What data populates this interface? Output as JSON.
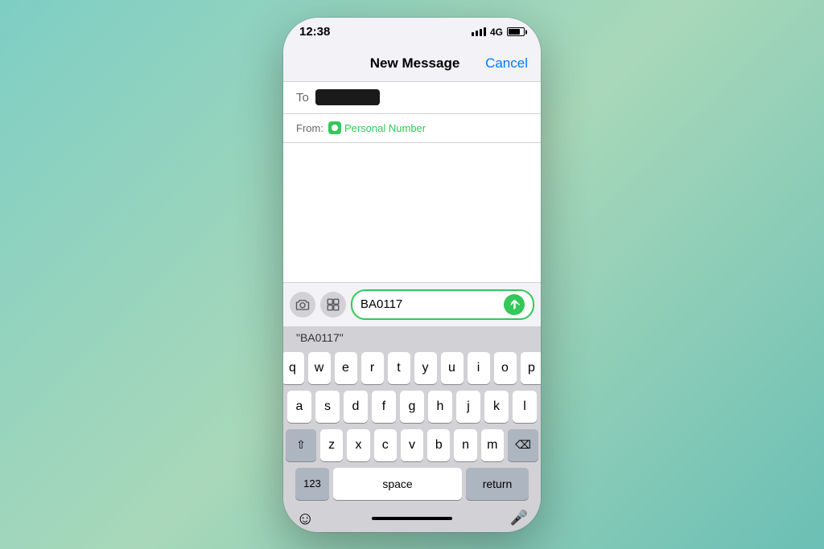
{
  "statusBar": {
    "time": "12:38",
    "signal": "4G",
    "battery": 80
  },
  "navBar": {
    "title": "New Message",
    "cancelLabel": "Cancel"
  },
  "compose": {
    "toLabel": "To",
    "fromLabel": "From:",
    "fromNumber": "Personal Number",
    "messageInputValue": "BA0117",
    "autocomplete": "\"BA0117\""
  },
  "toolbar": {
    "cameraLabel": "camera",
    "appLabel": "app",
    "sendLabel": "send"
  },
  "keyboard": {
    "row1": [
      "q",
      "w",
      "e",
      "r",
      "t",
      "y",
      "u",
      "i",
      "o",
      "p"
    ],
    "row2": [
      "a",
      "s",
      "d",
      "f",
      "g",
      "h",
      "j",
      "k",
      "l"
    ],
    "row3": [
      "z",
      "x",
      "c",
      "v",
      "b",
      "n",
      "m"
    ],
    "spaceLabel": "space",
    "returnLabel": "return",
    "numbersLabel": "123",
    "deleteLabel": "⌫"
  }
}
